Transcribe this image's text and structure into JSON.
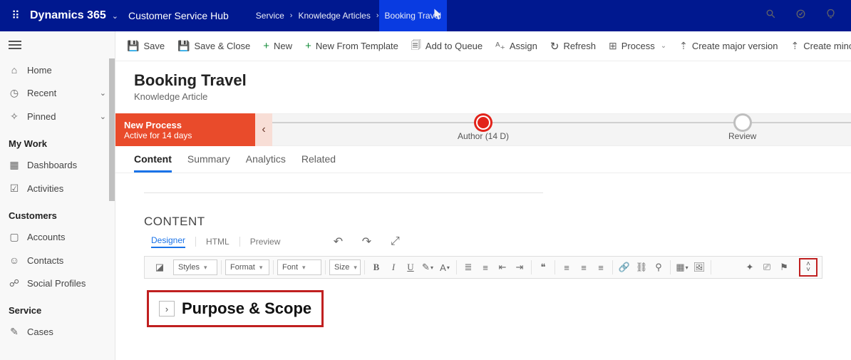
{
  "topbar": {
    "app_name": "Dynamics 365",
    "hub": "Customer Service Hub",
    "crumbs": [
      "Service",
      "Knowledge Articles",
      "Booking Travel"
    ],
    "icon_search": "search-icon",
    "icon_task": "task-icon",
    "icon_bulb": "bulb-icon"
  },
  "sidebar": {
    "items_top": [
      {
        "icon": "home-icon",
        "label": "Home"
      },
      {
        "icon": "clock-icon",
        "label": "Recent",
        "expandable": true
      },
      {
        "icon": "pin-icon",
        "label": "Pinned",
        "expandable": true
      }
    ],
    "group_mywork": {
      "title": "My Work",
      "items": [
        {
          "icon": "dashboard-icon",
          "label": "Dashboards"
        },
        {
          "icon": "activity-icon",
          "label": "Activities"
        }
      ]
    },
    "group_customers": {
      "title": "Customers",
      "items": [
        {
          "icon": "account-icon",
          "label": "Accounts"
        },
        {
          "icon": "contact-icon",
          "label": "Contacts"
        },
        {
          "icon": "social-icon",
          "label": "Social Profiles"
        }
      ]
    },
    "group_service": {
      "title": "Service",
      "items": [
        {
          "icon": "case-icon",
          "label": "Cases"
        }
      ]
    }
  },
  "commands": {
    "save": "Save",
    "save_close": "Save & Close",
    "new": "New",
    "new_tpl": "New From Template",
    "add_queue": "Add to Queue",
    "assign": "Assign",
    "refresh": "Refresh",
    "process": "Process",
    "major": "Create major version",
    "minor": "Create minor"
  },
  "record": {
    "title": "Booking Travel",
    "entity": "Knowledge Article"
  },
  "process": {
    "name": "New Process",
    "status": "Active for 14 days",
    "stages": {
      "author": "Author  (14 D)",
      "review": "Review"
    }
  },
  "tabs": [
    "Content",
    "Summary",
    "Analytics",
    "Related"
  ],
  "content": {
    "section_label": "CONTENT",
    "editor_tabs": [
      "Designer",
      "HTML",
      "Preview"
    ],
    "dropdowns": {
      "styles": "Styles",
      "format": "Format",
      "font": "Font",
      "size": "Size"
    },
    "heading_text": "Purpose & Scope"
  }
}
